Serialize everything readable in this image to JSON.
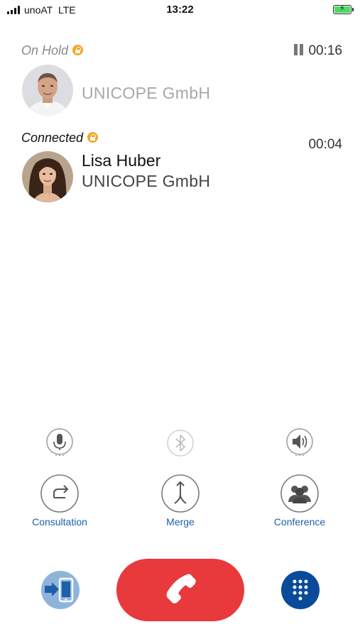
{
  "status_bar": {
    "carrier": "unoAT",
    "network": "LTE",
    "time": "13:22",
    "signal_bars": 4,
    "battery_level": 1.0,
    "battery_charging": true
  },
  "calls": [
    {
      "status": "On Hold",
      "timer": "00:16",
      "name": "",
      "company": "UNICOPE GmbH",
      "encrypted": true,
      "on_hold": true
    },
    {
      "status": "Connected",
      "timer": "00:04",
      "name": "Lisa Huber",
      "company": "UNICOPE GmbH",
      "encrypted": true,
      "on_hold": false
    }
  ],
  "audio_controls": [
    {
      "icon": "microphone-icon"
    },
    {
      "icon": "bluetooth-icon"
    },
    {
      "icon": "speaker-icon"
    }
  ],
  "actions": [
    {
      "label": "Consultation",
      "icon": "consultation-icon"
    },
    {
      "label": "Merge",
      "icon": "merge-icon"
    },
    {
      "label": "Conference",
      "icon": "conference-icon"
    }
  ],
  "bottom_bar": {
    "transfer_icon": "transfer-to-phone-icon",
    "end_call_icon": "end-call-icon",
    "keypad_icon": "keypad-icon"
  },
  "colors": {
    "accent": "#1d5fa8",
    "end_call": "#e8393d",
    "lock": "#f5a623",
    "on_hold_text": "#a8a8a8",
    "keypad": "#0a4a9a",
    "transfer": "#8fb4dc"
  }
}
